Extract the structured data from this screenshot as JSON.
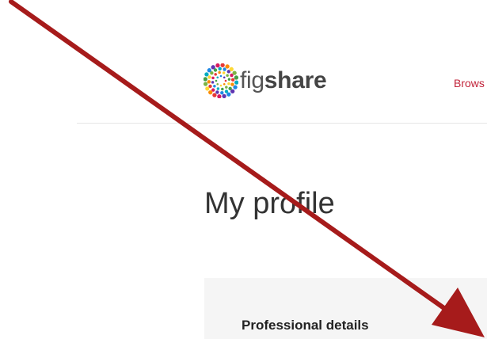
{
  "header": {
    "logo": {
      "text_light": "fig",
      "text_bold": "share",
      "icon": "figshare-logo-icon"
    },
    "nav": {
      "browse_label": "Brows"
    }
  },
  "main": {
    "page_title": "My profile",
    "panel": {
      "heading": "Professional details"
    }
  },
  "annotation": {
    "icon": "red-arrow",
    "color": "#a61b1b"
  },
  "colors": {
    "link": "#c2243a",
    "panel_background": "#f5f5f5",
    "divider": "#e5e5e5",
    "text": "#333333"
  }
}
